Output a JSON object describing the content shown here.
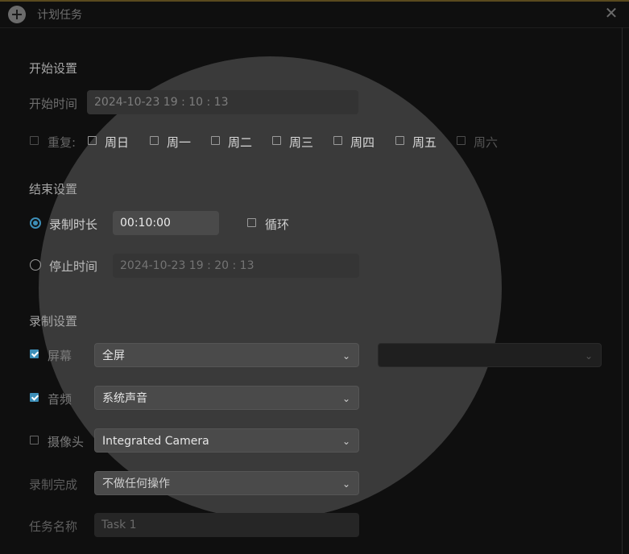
{
  "window": {
    "title": "计划任务",
    "close_glyph": "✕"
  },
  "start": {
    "section_title": "开始设置",
    "time_label": "开始时间",
    "time_value": "2024-10-23 19 : 10 : 13",
    "repeat_label": "重复:",
    "days": [
      "周日",
      "周一",
      "周二",
      "周三",
      "周四",
      "周五",
      "周六"
    ]
  },
  "end": {
    "section_title": "结束设置",
    "duration_label": "录制时长",
    "duration_value": "00:10:00",
    "loop_label": "循环",
    "stop_label": "停止时间",
    "stop_value": "2024-10-23 19 : 20 : 13",
    "selected": "duration"
  },
  "record": {
    "section_title": "录制设置",
    "screen_label": "屏幕",
    "screen_checked": true,
    "screen_value": "全屏",
    "screen_extra_value": "",
    "audio_label": "音频",
    "audio_checked": true,
    "audio_value": "系统声音",
    "camera_label": "摄像头",
    "camera_checked": false,
    "camera_value": "Integrated Camera",
    "complete_label": "录制完成",
    "complete_value": "不做任何操作",
    "task_label": "任务名称",
    "task_value": "Task 1"
  },
  "icons": {
    "app_logo": "plus-circle-icon",
    "close": "close-icon",
    "dropdown": "chevron-down-icon"
  },
  "colors": {
    "accent": "#3d8fb8",
    "background": "#0f0f0f",
    "spotlight": "#3a3a3a"
  }
}
